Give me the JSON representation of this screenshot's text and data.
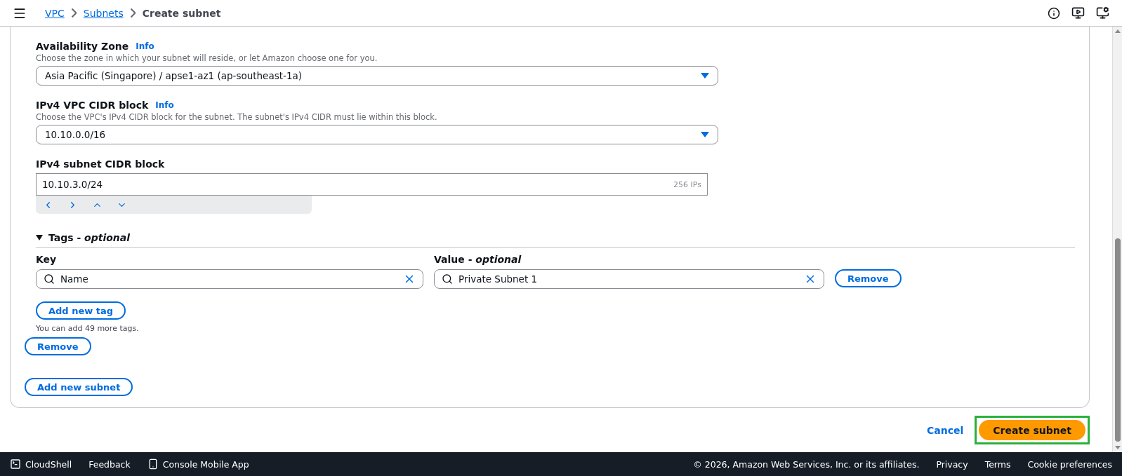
{
  "breadcrumbs": [
    {
      "label": "VPC",
      "link": true
    },
    {
      "label": "Subnets",
      "link": true
    },
    {
      "label": "Create subnet",
      "link": false
    }
  ],
  "fields": [
    {
      "kind": "select",
      "label": "Availability Zone",
      "info": "Info",
      "description": "Choose the zone in which your subnet will reside, or let Amazon choose one for you.",
      "value": "Asia Pacific (Singapore) / apse1-az1 (ap-southeast-1a)"
    },
    {
      "kind": "select",
      "label": "IPv4 VPC CIDR block",
      "info": "Info",
      "description": "Choose the VPC's IPv4 CIDR block for the subnet. The subnet's IPv4 CIDR must lie within this block.",
      "value": "10.10.0.0/16"
    },
    {
      "kind": "cidr",
      "label": "IPv4 subnet CIDR block",
      "value": "10.10.3.0/24",
      "suffix": "256 IPs"
    }
  ],
  "tags": {
    "title": "Tags - *optional*",
    "expanded": true,
    "key_label": "Key",
    "value_label": "Value - *optional*",
    "rows": [
      {
        "key": "Name",
        "value": "Private Subnet 1",
        "remove": "Remove"
      }
    ],
    "add_button": "Add new tag",
    "hint": "You can add 49 more tags."
  },
  "remove_subnet": "Remove",
  "add_subnet": "Add new subnet",
  "actions": {
    "cancel": "Cancel",
    "create": "Create subnet",
    "create_highlighted": true
  },
  "footer": {
    "cloudshell": "CloudShell",
    "feedback": "Feedback",
    "mobile": "Console Mobile App",
    "copyright": "© 2026, Amazon Web Services, Inc. or its affiliates.",
    "links": [
      "Privacy",
      "Terms",
      "Cookie preferences"
    ]
  }
}
